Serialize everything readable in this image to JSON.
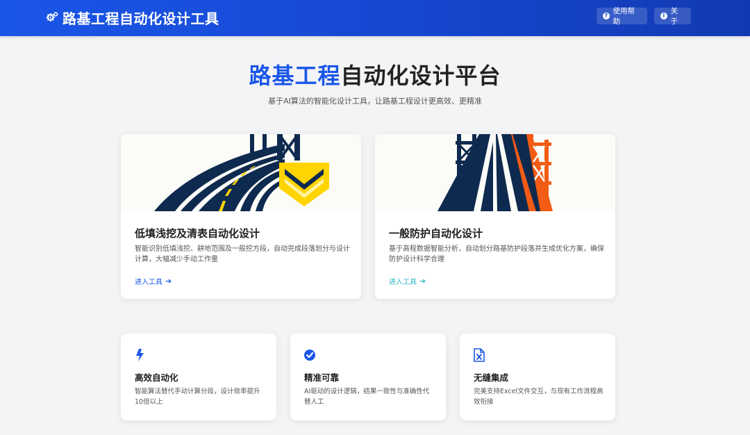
{
  "header": {
    "title": "路基工程自动化设计工具",
    "help_label": "使用帮助",
    "about_label": "关于"
  },
  "hero": {
    "title_accent": "路基工程",
    "title_rest": "自动化设计平台",
    "subtitle": "基于AI算法的智能化设计工具，让路基工程设计更高效、更精准"
  },
  "tools": [
    {
      "title": "低填浅挖及清表自动化设计",
      "description": "智能识别低填浅挖、耕地范围及一般挖方段，自动完成段落划分与设计计算，大幅减少手动工作量",
      "link": "进入工具"
    },
    {
      "title": "一般防护自动化设计",
      "description": "基于高程数据智能分析，自动划分路基防护段落并生成优化方案，确保防护设计科学合理",
      "link": "进入工具"
    }
  ],
  "features": [
    {
      "icon": "bolt-icon",
      "title": "高效自动化",
      "description": "智能算法替代手动计算分段，设计效率提升10倍以上"
    },
    {
      "icon": "check-circle-icon",
      "title": "精准可靠",
      "description": "AI驱动的设计逻辑，结果一致性与准确性代替人工"
    },
    {
      "icon": "excel-file-icon",
      "title": "无缝集成",
      "description": "完美支持Excel文件交互，与现有工作流程高效衔接"
    }
  ],
  "colors": {
    "primary": "#1a56e8",
    "teal": "#2bb5c7",
    "navy": "#0f2a4f",
    "yellow": "#ffd400",
    "orange": "#f25c14"
  }
}
